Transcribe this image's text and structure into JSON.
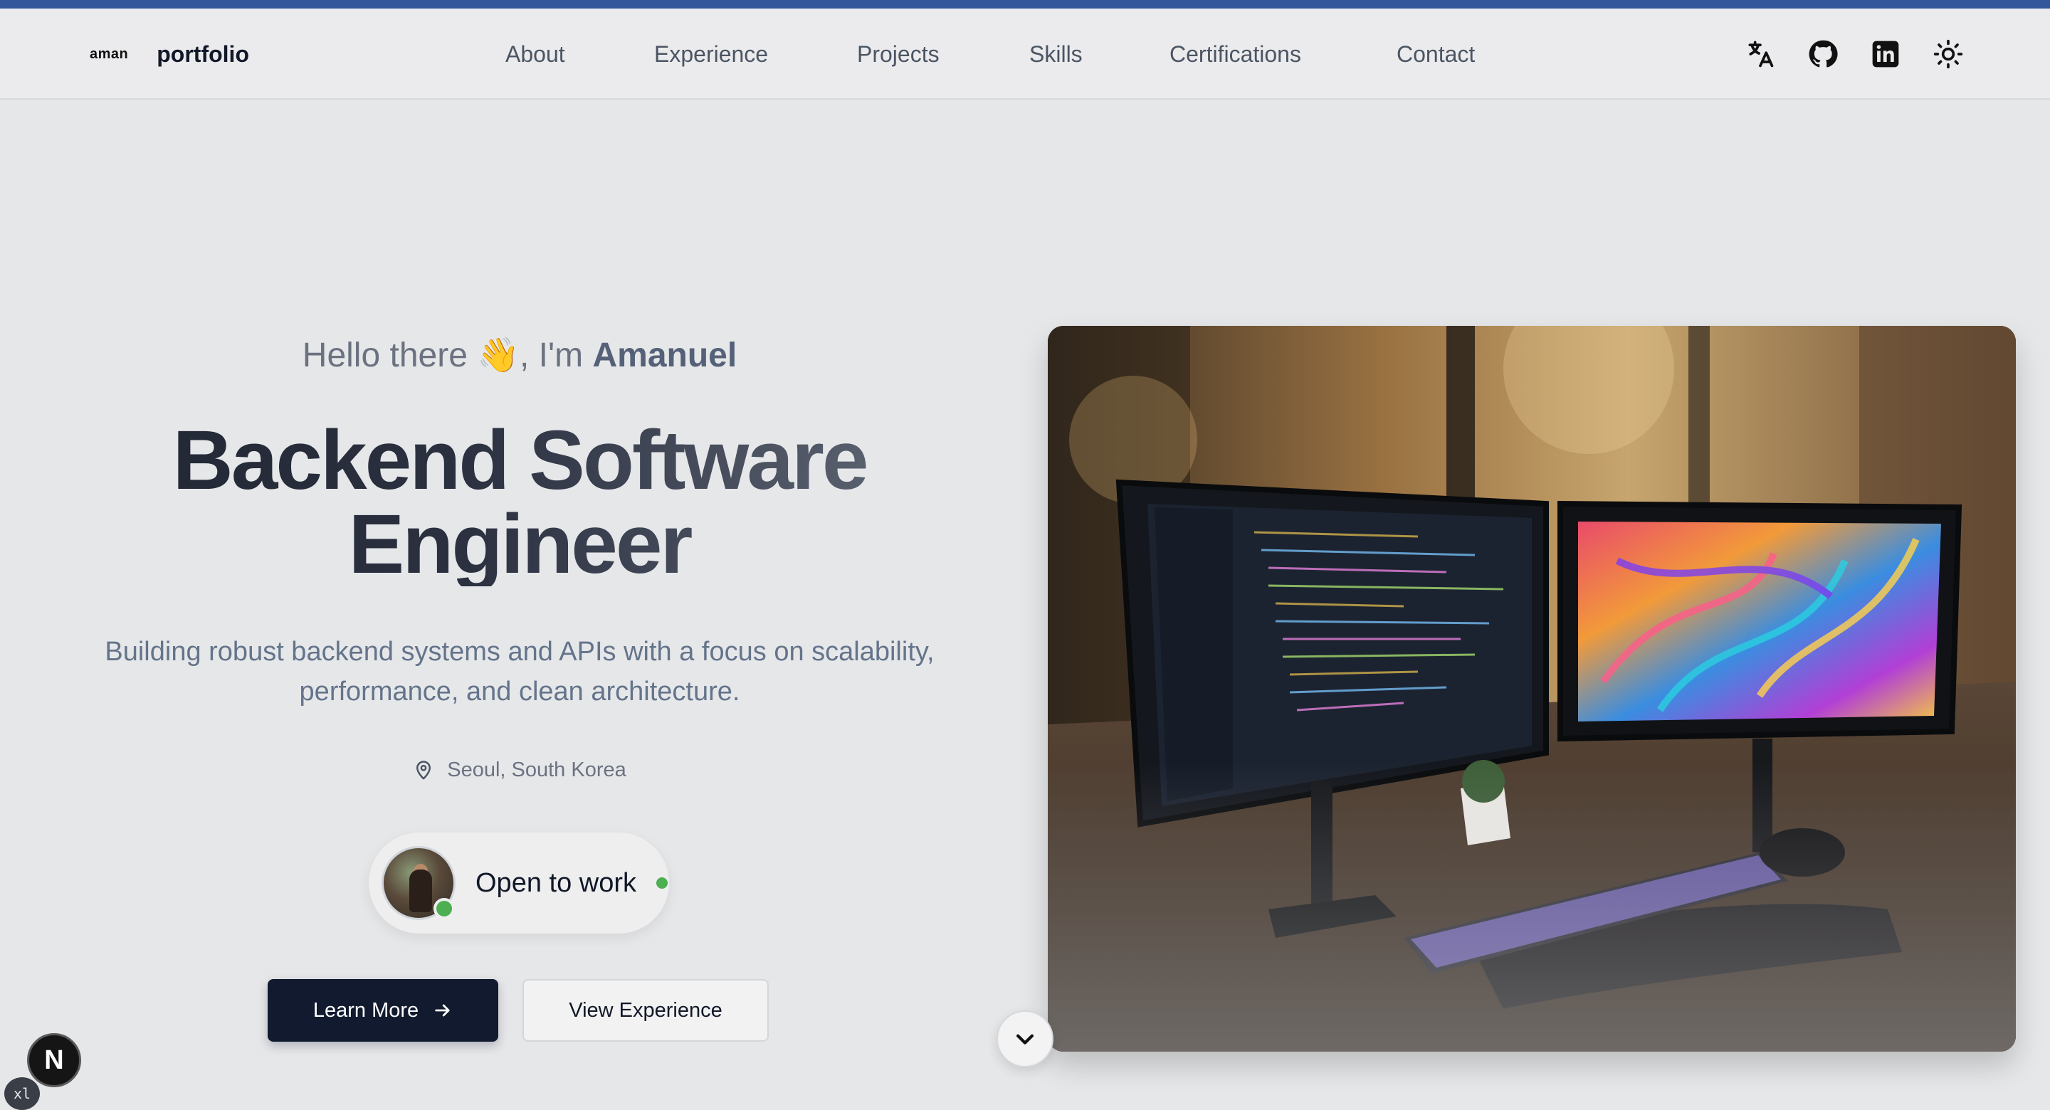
{
  "nav": {
    "brand_mark": "aman",
    "brand_name": "portfolio",
    "links": [
      "About",
      "Experience",
      "Projects",
      "Skills",
      "Certifications",
      "Contact"
    ],
    "icons": [
      "translate-icon",
      "github-icon",
      "linkedin-icon",
      "sun-icon"
    ]
  },
  "hero": {
    "greeting_prefix": "Hello there 👋, I'm ",
    "greeting_name": "Amanuel",
    "title_line1": "Backend Software",
    "title_line2": "Engineer",
    "subtitle": "Building robust backend systems and APIs with a focus on scalability, performance, and clean architecture.",
    "location": "Seoul, South Korea",
    "status": "Open to work",
    "primary_cta": "Learn More",
    "secondary_cta": "View Experience"
  },
  "devtools": {
    "next_badge": "N",
    "breakpoint_badge": "xl"
  },
  "colors": {
    "accent_bar": "#34569a",
    "primary_button": "#111a2e",
    "online_green": "#4caf50"
  }
}
